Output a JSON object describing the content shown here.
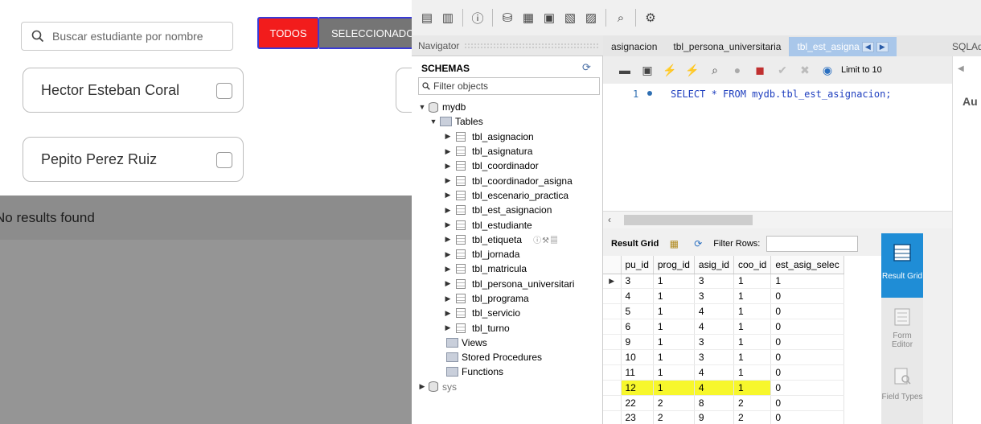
{
  "webapp": {
    "search": {
      "placeholder": "Buscar estudiante por nombre"
    },
    "buttons": {
      "todos": "TODOS",
      "seleccionados": "SELECCIONADOS"
    },
    "students": [
      {
        "name": "Hector Esteban Coral"
      },
      {
        "name": "Pepito Perez Ruiz"
      }
    ],
    "no_results": "No results found"
  },
  "workbench": {
    "navigator": {
      "title": "Navigator",
      "schemas_label": "SCHEMAS",
      "filter_placeholder": "Filter objects",
      "schema_mydb": "mydb",
      "tables_label": "Tables",
      "tables": [
        "tbl_asignacion",
        "tbl_asignatura",
        "tbl_coordinador",
        "tbl_coordinador_asigna",
        "tbl_escenario_practica",
        "tbl_est_asignacion",
        "tbl_estudiante",
        "tbl_etiqueta",
        "tbl_jornada",
        "tbl_matricula",
        "tbl_persona_universitari",
        "tbl_programa",
        "tbl_servicio",
        "tbl_turno"
      ],
      "views_label": "Views",
      "stored_procedures_label": "Stored Procedures",
      "functions_label": "Functions",
      "schema_sys": "sys"
    },
    "tabs": [
      {
        "label": "asignacion"
      },
      {
        "label": "tbl_persona_universitaria"
      },
      {
        "label": "tbl_est_asigna"
      }
    ],
    "sql_additions_label": "SQLAd",
    "limit_label": "Limit to 10",
    "editor": {
      "line_number": "1",
      "query": "SELECT * FROM mydb.tbl_est_asignacion;"
    },
    "right_panel_text": "Au",
    "result": {
      "grid_label": "Result Grid",
      "filter_rows_label": "Filter Rows:",
      "columns": [
        "pu_id",
        "prog_id",
        "asig_id",
        "coo_id",
        "est_asig_selec"
      ],
      "rows": [
        [
          "3",
          "1",
          "3",
          "1",
          "1"
        ],
        [
          "4",
          "1",
          "3",
          "1",
          "0"
        ],
        [
          "5",
          "1",
          "4",
          "1",
          "0"
        ],
        [
          "6",
          "1",
          "4",
          "1",
          "0"
        ],
        [
          "9",
          "1",
          "3",
          "1",
          "0"
        ],
        [
          "10",
          "1",
          "3",
          "1",
          "0"
        ],
        [
          "11",
          "1",
          "4",
          "1",
          "0"
        ],
        [
          "12",
          "1",
          "4",
          "1",
          "0"
        ],
        [
          "22",
          "2",
          "8",
          "2",
          "0"
        ],
        [
          "23",
          "2",
          "9",
          "2",
          "0"
        ]
      ],
      "highlight_color": "#f7f72c"
    },
    "side_panel": {
      "result_grid": "Result Grid",
      "form_editor": "Form Editor",
      "field_types": "Field Types"
    }
  },
  "colors": {
    "todos_red": "#f21c1c",
    "selected_gray": "#757575",
    "workbench_blue": "#1f8dd6"
  }
}
